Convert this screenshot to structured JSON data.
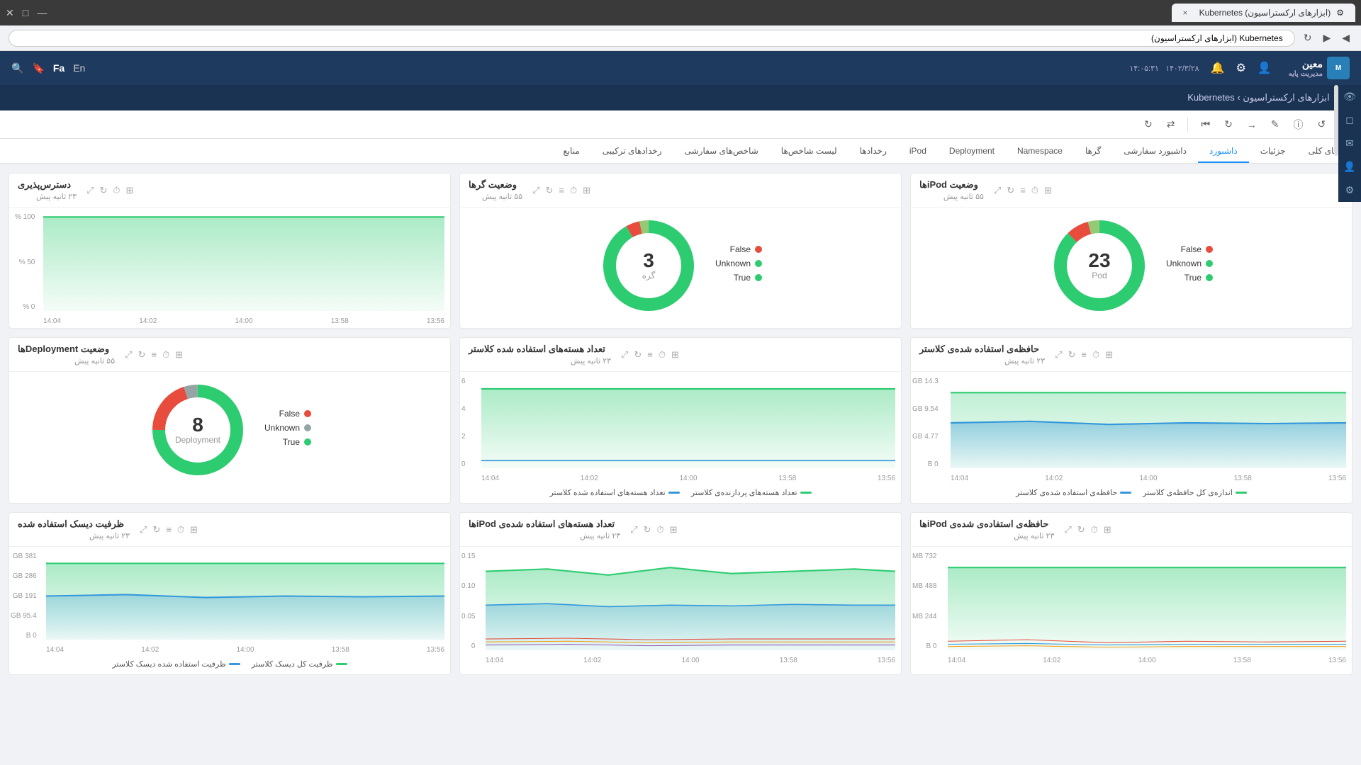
{
  "browser": {
    "tab_title": "(ابزارهای ارکستراسیون) Kubernetes",
    "close_label": "×",
    "address": "Kubernetes (ابزارهای ارکستراسیون)"
  },
  "header": {
    "logo_text": "معین",
    "logo_sub": "مدیریت پایه",
    "datetime": "۱۴۰۲/۳/۲۸",
    "time": "۱۴:۰۵:۳۱",
    "lang_en": "En",
    "lang_fa": "Fa"
  },
  "breadcrumb": {
    "text": "ابزارهای ارکستراسیون › Kubernetes"
  },
  "toolbar": {
    "buttons": [
      "⊞",
      "↺",
      "⊙",
      "✎",
      "→",
      "↻",
      "⏮",
      "|",
      "⇄",
      "↻"
    ]
  },
  "nav_tabs": {
    "tabs": [
      {
        "label": "نمای کلی",
        "active": false
      },
      {
        "label": "جزئیات",
        "active": false
      },
      {
        "label": "داشبورد",
        "active": true
      },
      {
        "label": "داشبورد سفارشی",
        "active": false
      },
      {
        "label": "گرها",
        "active": false
      },
      {
        "label": "Namespace",
        "active": false
      },
      {
        "label": "Deployment",
        "active": false
      },
      {
        "label": "iPod",
        "active": false
      },
      {
        "label": "رخدادها",
        "active": false
      },
      {
        "label": "لیست شاخص‌ها",
        "active": false
      },
      {
        "label": "شاخص‌های سفارشی",
        "active": false
      },
      {
        "label": "رخدادهای ترکیبی",
        "active": false
      },
      {
        "label": "منابع",
        "active": false
      }
    ]
  },
  "panels": {
    "pod_status": {
      "title": "وضعیت iPodها",
      "subtitle": "۵۵ ثانیه پیش",
      "center_value": "23",
      "center_label": "Pod",
      "legend": [
        {
          "label": "False",
          "color": "red"
        },
        {
          "label": "Unknown",
          "color": "green"
        },
        {
          "label": "True",
          "color": "green"
        }
      ],
      "donut": {
        "true_pct": 88,
        "false_pct": 8,
        "unknown_pct": 4
      }
    },
    "node_status": {
      "title": "وضعیت گرها",
      "subtitle": "۵۵ ثانیه پیش",
      "center_value": "3",
      "center_label": "گره",
      "legend": [
        {
          "label": "False",
          "color": "red"
        },
        {
          "label": "Unknown",
          "color": "green"
        },
        {
          "label": "True",
          "color": "green"
        }
      ],
      "donut": {
        "true_pct": 92,
        "false_pct": 5,
        "unknown_pct": 3
      }
    },
    "accessibility": {
      "title": "دسترس‌پذیری",
      "subtitle": "۲۳ ثانیه پیش",
      "y_labels": [
        "100 %",
        "50 %",
        "0 %"
      ],
      "x_labels": [
        "13:56",
        "13:58",
        "14:00",
        "14:02",
        "14:04"
      ]
    },
    "cluster_memory": {
      "title": "حافظه‌ی استفاده شده‌ی کلاستر",
      "subtitle": "۲۳ ثانیه پیش",
      "y_labels": [
        "14.3 GB",
        "9.54 GB",
        "4.77 GB",
        "0 B"
      ],
      "x_labels": [
        "13:56",
        "13:58",
        "14:00",
        "14:02",
        "14:04"
      ],
      "legend": [
        {
          "label": "اندازه‌ی کل حافظه‌ی کلاستر",
          "color": "#2ecc71"
        },
        {
          "label": "حافظه‌ی استفاده شده‌ی کلاستر",
          "color": "#3498db"
        }
      ]
    },
    "cluster_cpu": {
      "title": "تعداد هسته‌های استفاده شده کلاستر",
      "subtitle": "۲۳ ثانیه پیش",
      "y_labels": [
        "6",
        "4",
        "2",
        "0"
      ],
      "x_labels": [
        "13:56",
        "13:58",
        "14:00",
        "14:02",
        "14:04"
      ],
      "legend": [
        {
          "label": "تعداد هسته‌های پردازنده‌ی کلاستر",
          "color": "#2ecc71"
        },
        {
          "label": "تعداد هسته‌های استفاده شده کلاستر",
          "color": "#3498db"
        }
      ]
    },
    "deployment_status": {
      "title": "وضعیت Deploymentها",
      "subtitle": "۵۵ ثانیه پیش",
      "center_value": "8",
      "center_label": "Deployment",
      "legend": [
        {
          "label": "False",
          "color": "red"
        },
        {
          "label": "Unknown",
          "color": "gray"
        },
        {
          "label": "True",
          "color": "green"
        }
      ],
      "donut": {
        "true_pct": 75,
        "false_pct": 20,
        "unknown_pct": 5
      }
    },
    "pod_memory": {
      "title": "حافظه‌ی استفاده‌ی شده‌ی iPodها",
      "subtitle": "۲۳ ثانیه پیش",
      "y_labels": [
        "732 MB",
        "488 MB",
        "244 MB",
        "0 B"
      ],
      "x_labels": [
        "13:56",
        "13:58",
        "14:00",
        "14:02",
        "14:04"
      ]
    },
    "pod_cpu": {
      "title": "تعداد هسته‌های استفاده شده‌ی iPodها",
      "subtitle": "۲۳ ثانیه پیش",
      "y_labels": [
        "0.15",
        "0.10",
        "0.05",
        "0"
      ],
      "x_labels": [
        "13:56",
        "13:58",
        "14:00",
        "14:02",
        "14:04"
      ]
    },
    "disk_capacity": {
      "title": "ظرفیت دیسک استفاده شده",
      "subtitle": "۲۳ ثانیه پیش",
      "y_labels": [
        "381 GB",
        "286 GB",
        "191 GB",
        "95.4 GB",
        "0 B"
      ],
      "x_labels": [
        "13:56",
        "13:58",
        "14:00",
        "14:02",
        "14:04"
      ],
      "legend": [
        {
          "label": "ظرفیت کل دیسک کلاستر",
          "color": "#2ecc71"
        },
        {
          "label": "ظرفیت استفاده شده دیسک کلاستر",
          "color": "#3498db"
        }
      ]
    }
  },
  "colors": {
    "green": "#2ecc71",
    "red": "#e74c3c",
    "blue": "#3498db",
    "gray": "#95a5a6",
    "header_bg": "#1e3a5f",
    "nav_bg": "#1a3352",
    "accent": "#1890ff"
  }
}
